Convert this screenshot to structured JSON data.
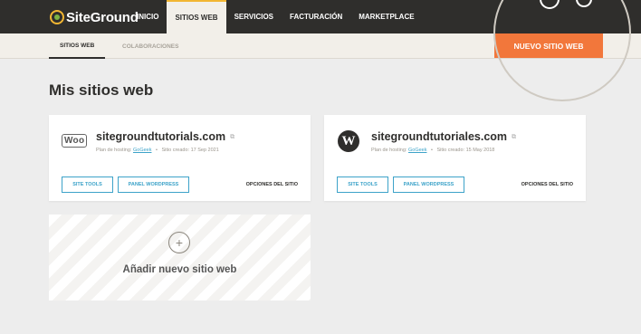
{
  "app": {
    "logo_text": "SiteGround"
  },
  "nav": {
    "items": [
      {
        "label": "INICIO"
      },
      {
        "label": "SITIOS WEB"
      },
      {
        "label": "SERVICIOS"
      },
      {
        "label": "FACTURACIÓN"
      },
      {
        "label": "MARKETPLACE"
      }
    ],
    "active_index": 1
  },
  "subnav": {
    "tabs": [
      {
        "label": "SITIOS WEB"
      },
      {
        "label": "COLABORACIONES"
      }
    ]
  },
  "toolbar": {
    "new_site_label": "NUEVO SITIO WEB"
  },
  "page": {
    "title": "Mis sitios web"
  },
  "sites": [
    {
      "name": "sitegroundtutorials.com",
      "logo": "woocommerce-logo",
      "logo_text": "Woo",
      "plan_prefix": "Plan de hosting:",
      "plan_link": "GoGeek",
      "created": "Sitio creado: 17 Sep 2021",
      "site_tools_label": "SITE TOOLS",
      "wp_panel_label": "PANEL WORDPRESS",
      "options_label": "OPCIONES DEL SITIO"
    },
    {
      "name": "sitegroundtutoriales.com",
      "logo": "wordpress-logo",
      "logo_text": "W",
      "plan_prefix": "Plan de hosting:",
      "plan_link": "GoGeek",
      "created": "Sitio creado: 15 May 2018",
      "site_tools_label": "SITE TOOLS",
      "wp_panel_label": "PANEL WORDPRESS",
      "options_label": "OPCIONES DEL SITIO"
    }
  ],
  "add_card": {
    "icon": "+",
    "label": "Añadir nuevo sitio web"
  },
  "colors": {
    "accent": "#f2773b",
    "link": "#3da3c9",
    "topbar": "#2f2e2c"
  }
}
